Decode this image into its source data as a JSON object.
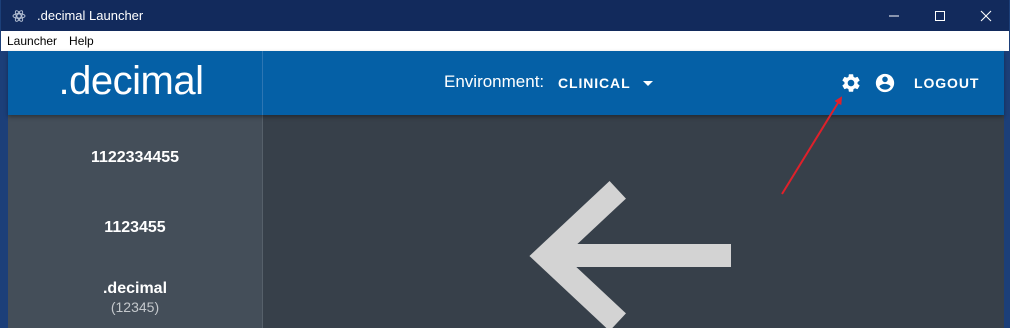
{
  "window": {
    "title": ".decimal Launcher",
    "controls": [
      "minimize",
      "maximize",
      "close"
    ]
  },
  "menubar": {
    "items": [
      {
        "label": "Launcher"
      },
      {
        "label": "Help"
      }
    ]
  },
  "header": {
    "logo": ".decimal",
    "environment_label": "Environment:",
    "environment_value": "CLINICAL",
    "settings_icon": "gear-icon",
    "account_icon": "account-circle-icon",
    "logout_label": "LOGOUT"
  },
  "sidebar": {
    "items": [
      {
        "label": "1122334455",
        "sub": ""
      },
      {
        "label": "1123455",
        "sub": ""
      },
      {
        "label": ".decimal",
        "sub": "(12345)"
      }
    ]
  },
  "colors": {
    "titlebar": "#122a5c",
    "header": "#0560a6",
    "sidebar": "#444e59",
    "main": "#37404a",
    "arrow": "#d3d3d3",
    "annotation": "#e0202a"
  }
}
